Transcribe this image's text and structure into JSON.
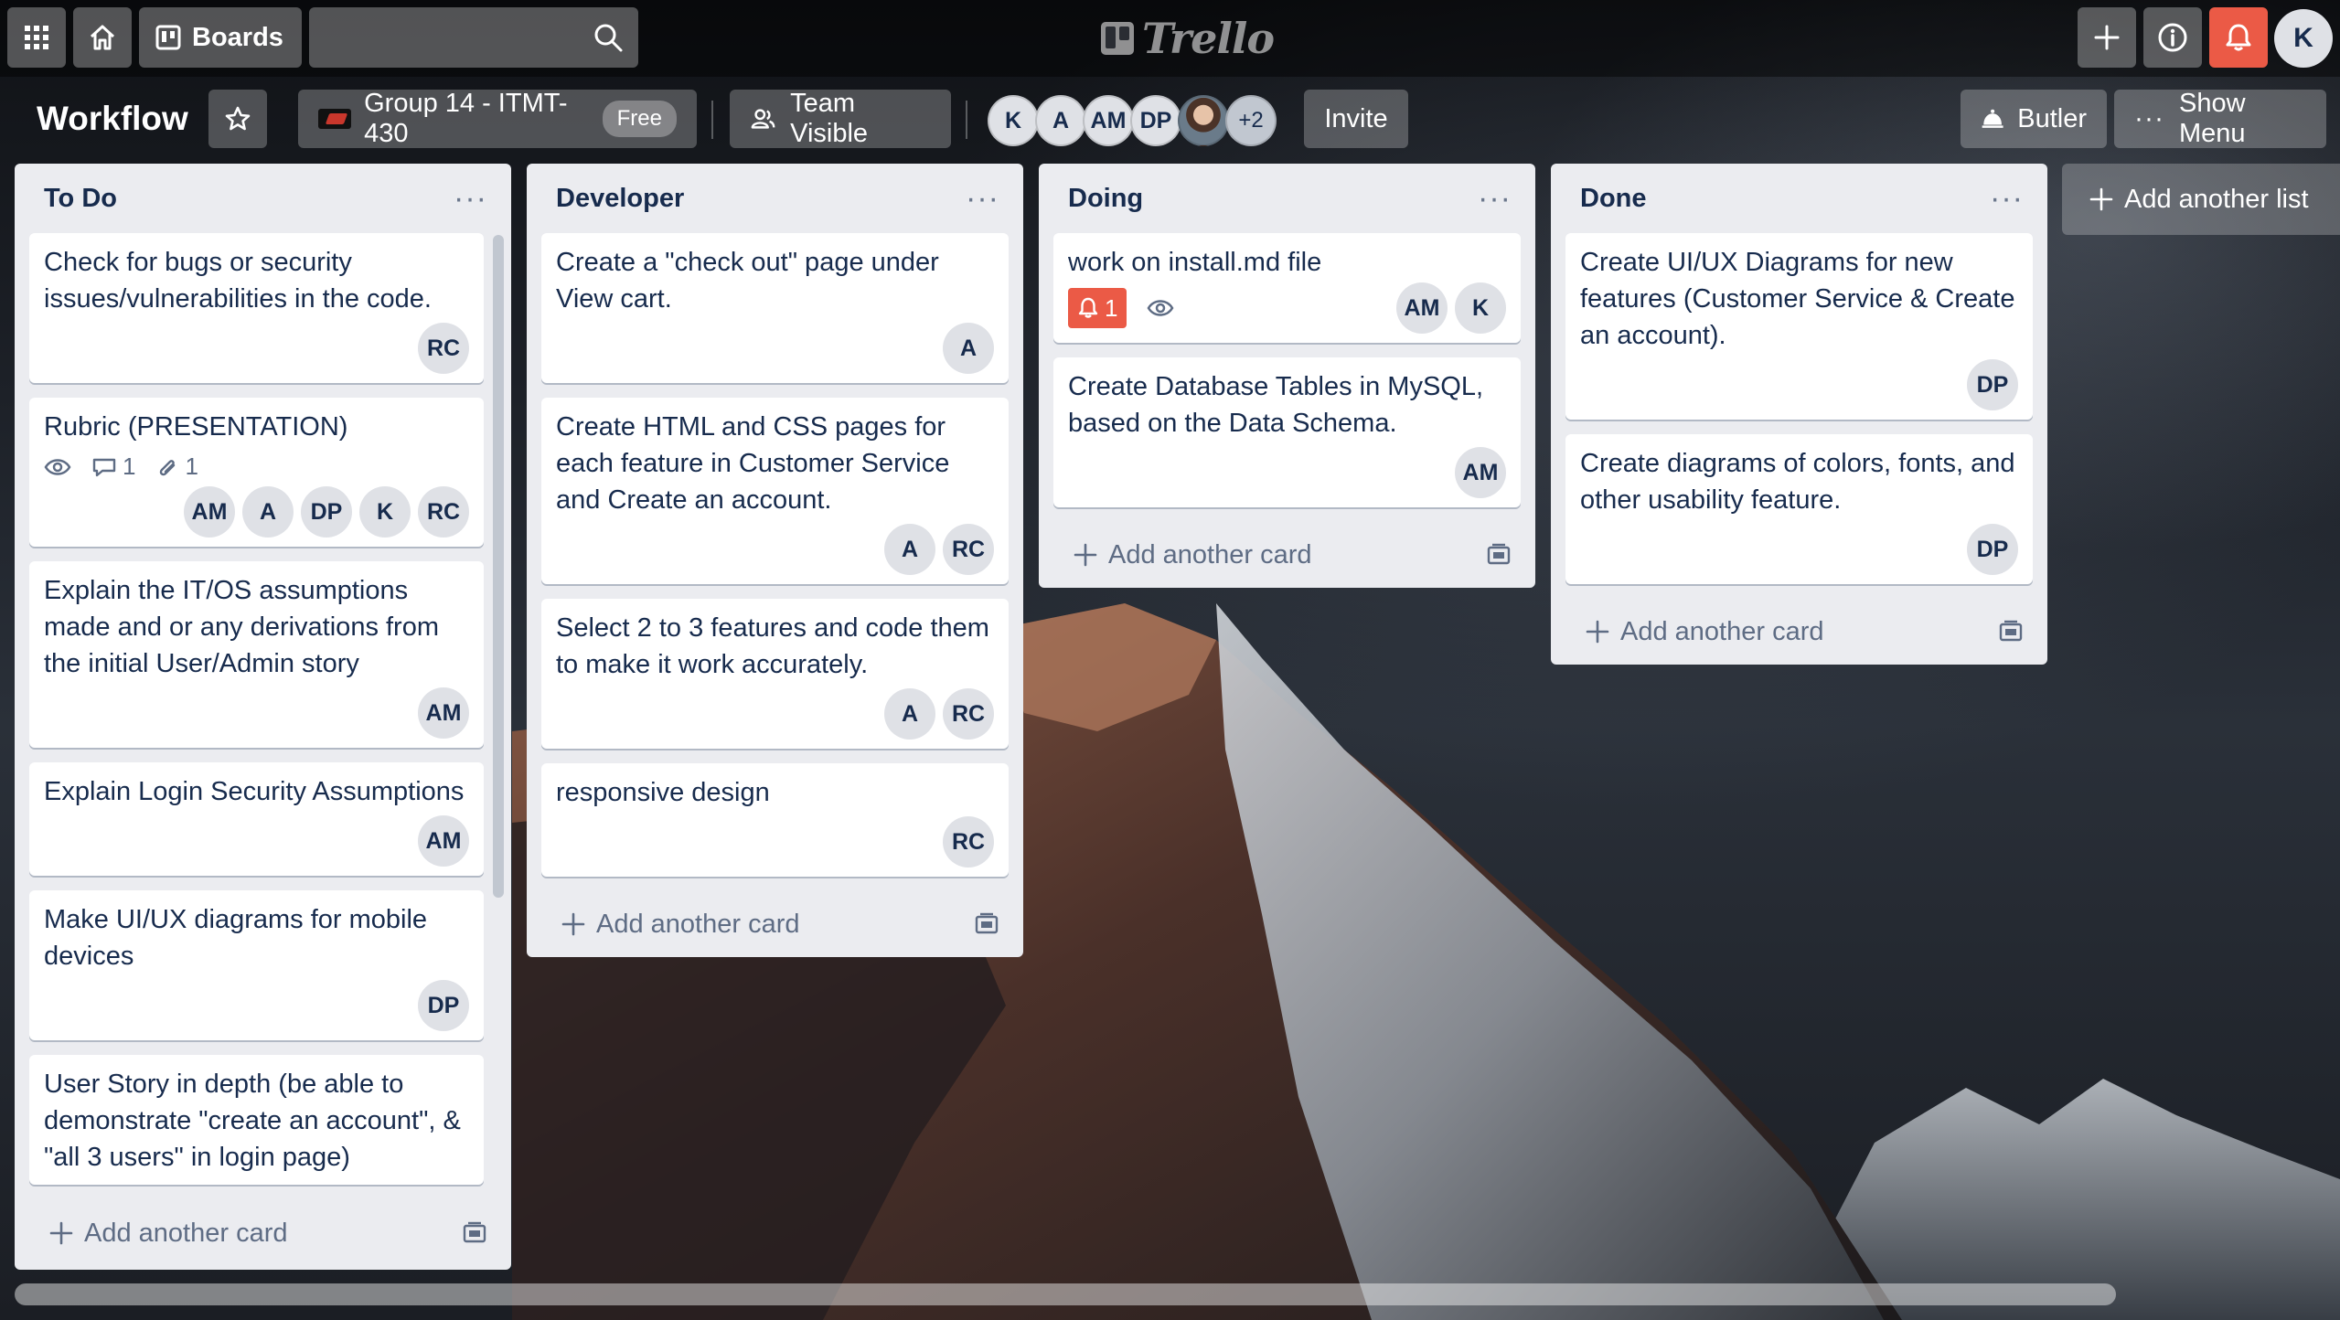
{
  "header": {
    "boards_label": "Boards",
    "search_value": "",
    "logo_text": "Trello",
    "user_initial": "K"
  },
  "board": {
    "title": "Workflow",
    "team_name": "Group 14 - ITMT-430",
    "plan_badge": "Free",
    "visibility": "Team Visible",
    "members": [
      "K",
      "A",
      "AM",
      "DP"
    ],
    "members_more": "+2",
    "invite_label": "Invite",
    "butler_label": "Butler",
    "menu_label": "Show Menu"
  },
  "lists": [
    {
      "title": "To Do",
      "cards": [
        {
          "title": "Check for bugs or security issues/vulnerabilities in the code.",
          "members": [
            "RC"
          ]
        },
        {
          "title": "Rubric (PRESENTATION)",
          "comments": "1",
          "attachments": "1",
          "members": [
            "AM",
            "A",
            "DP",
            "K",
            "RC"
          ]
        },
        {
          "title": "Explain the IT/OS assumptions made and or any derivations from the initial User/Admin story",
          "members": [
            "AM"
          ]
        },
        {
          "title": "Explain Login Security Assumptions",
          "members": [
            "AM"
          ]
        },
        {
          "title": "Make UI/UX diagrams for mobile devices",
          "members": [
            "DP"
          ]
        },
        {
          "title": "User Story in depth (be able to demonstrate \"create an account\", & \"all 3 users\" in login page)",
          "members": []
        }
      ],
      "add_card": "Add another card"
    },
    {
      "title": "Developer",
      "cards": [
        {
          "title": "Create a \"check out\" page under View cart.",
          "members": [
            "A"
          ]
        },
        {
          "title": "Create HTML and CSS pages for each feature in Customer Service and Create an account.",
          "members": [
            "A",
            "RC"
          ]
        },
        {
          "title": "Select 2 to 3 features and code them to make it work accurately.",
          "members": [
            "A",
            "RC"
          ]
        },
        {
          "title": "responsive design",
          "members": [
            "RC"
          ]
        }
      ],
      "add_card": "Add another card"
    },
    {
      "title": "Doing",
      "cards": [
        {
          "title": "work on install.md file",
          "due": "1",
          "members": [
            "AM",
            "K"
          ]
        },
        {
          "title": "Create Database Tables in MySQL, based on the Data Schema.",
          "members": [
            "AM"
          ]
        }
      ],
      "add_card": "Add another card"
    },
    {
      "title": "Done",
      "cards": [
        {
          "title": "Create UI/UX Diagrams for new features (Customer Service & Create an account).",
          "members": [
            "DP"
          ]
        },
        {
          "title": "Create diagrams of colors, fonts, and other usability feature.",
          "members": [
            "DP"
          ]
        }
      ],
      "add_card": "Add another card"
    }
  ],
  "add_list_label": "Add another list"
}
